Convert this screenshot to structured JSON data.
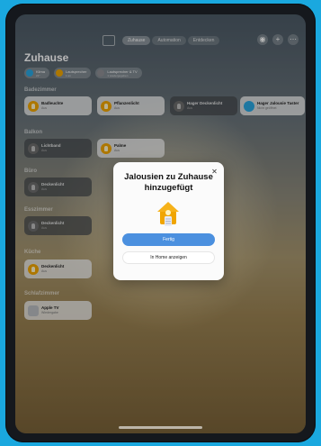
{
  "nav": {
    "tabs": [
      {
        "label": "Zuhause",
        "active": true
      },
      {
        "label": "Automation",
        "active": false
      },
      {
        "label": "Entdecken",
        "active": false
      }
    ]
  },
  "home": {
    "title": "Zuhause"
  },
  "chips": [
    {
      "label": "Klima",
      "sub": "21°",
      "color": "#29a6e0"
    },
    {
      "label": "Lautsprecher",
      "sub": "1 an",
      "color": "#f0a500"
    },
    {
      "label": "Lautsprecher & TV",
      "sub": "1 wiedergegeben",
      "color": "#8e8e93"
    }
  ],
  "sections": {
    "s1": "Badezimmer",
    "s2": "Balkon",
    "s3": "Büro",
    "s4": "Esszimmer",
    "s5": "Küche",
    "s6": "Schlafzimmer"
  },
  "tiles": {
    "badleuchte": {
      "name": "Badleuchte",
      "status": "Aus"
    },
    "pflanzenlicht": {
      "name": "Pflanzenlicht",
      "status": "Aus"
    },
    "hager_deckenlicht": {
      "name": "Hager Deckenlicht",
      "status": "Aus"
    },
    "hager_jalousie": {
      "name": "Hager Jalousie Taster",
      "status": "Nicht geöffnet"
    },
    "lichtband": {
      "name": "Lichtband",
      "status": "Aus"
    },
    "palme": {
      "name": "Palme",
      "status": "Aus"
    },
    "buero_deckenlicht": {
      "name": "Deckenlicht",
      "status": "Aus"
    },
    "ess_deckenlicht": {
      "name": "Deckenlicht",
      "status": "Aus"
    },
    "kueche_deckenlicht": {
      "name": "Deckenlicht",
      "status": "Aus"
    },
    "apple_tv": {
      "name": "Apple TV",
      "status": "Wiedergabe"
    }
  },
  "modal": {
    "title": "Jalousien zu Zuhause hinzugefügt",
    "primary_label": "Fertig",
    "secondary_label": "In Home anzeigen",
    "close_icon": "close-icon",
    "icon": "house-icon"
  },
  "colors": {
    "background": "#1aa8df",
    "accent": "#4b90df",
    "light_icon": "#f0a500"
  }
}
